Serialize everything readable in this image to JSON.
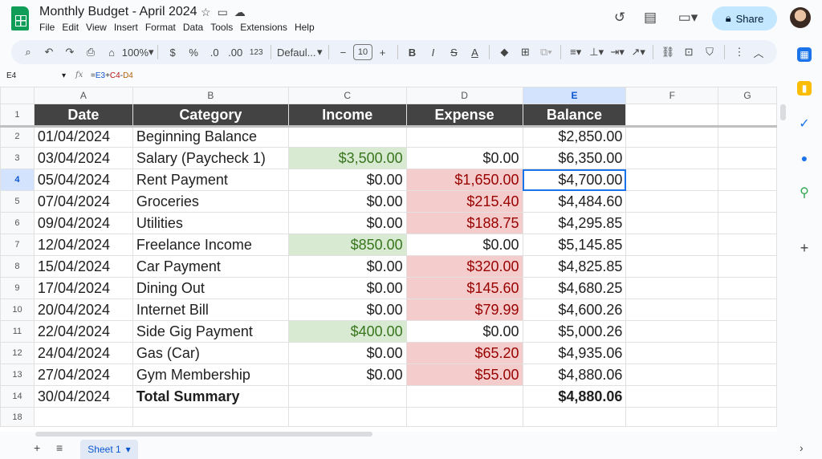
{
  "app": {
    "title": "Monthly Budget - April 2024",
    "share_label": "Share"
  },
  "menu": [
    "File",
    "Edit",
    "View",
    "Insert",
    "Format",
    "Data",
    "Tools",
    "Extensions",
    "Help"
  ],
  "toolbar": {
    "zoom": "100%",
    "currency": "$",
    "percent": "%",
    "decrease_decimal": ".0",
    "increase_decimal": ".00",
    "number_format": "123",
    "font": "Defaul...",
    "font_size": "10"
  },
  "formula_bar": {
    "name_box": "E4",
    "fx": "fx",
    "formula_prefix": "=",
    "ref1": "E3",
    "op1": "+",
    "ref2": "C4",
    "op2": "-",
    "ref3": "D4"
  },
  "columns": [
    "A",
    "B",
    "C",
    "D",
    "E",
    "F",
    "G"
  ],
  "table_headers": [
    "Date",
    "Category",
    "Income",
    "Expense",
    "Balance"
  ],
  "rows": [
    {
      "n": "2",
      "date": "01/04/2024",
      "category": "Beginning Balance",
      "income": "",
      "expense": "",
      "balance": "$2,850.00"
    },
    {
      "n": "3",
      "date": "03/04/2024",
      "category": "Salary (Paycheck 1)",
      "income": "$3,500.00",
      "expense": "$0.00",
      "balance": "$6,350.00"
    },
    {
      "n": "4",
      "date": "05/04/2024",
      "category": "Rent Payment",
      "income": "$0.00",
      "expense": "$1,650.00",
      "balance": "$4,700.00"
    },
    {
      "n": "5",
      "date": "07/04/2024",
      "category": "Groceries",
      "income": "$0.00",
      "expense": "$215.40",
      "balance": "$4,484.60"
    },
    {
      "n": "6",
      "date": "09/04/2024",
      "category": "Utilities",
      "income": "$0.00",
      "expense": "$188.75",
      "balance": "$4,295.85"
    },
    {
      "n": "7",
      "date": "12/04/2024",
      "category": "Freelance Income",
      "income": "$850.00",
      "expense": "$0.00",
      "balance": "$5,145.85"
    },
    {
      "n": "8",
      "date": "15/04/2024",
      "category": "Car Payment",
      "income": "$0.00",
      "expense": "$320.00",
      "balance": "$4,825.85"
    },
    {
      "n": "9",
      "date": "17/04/2024",
      "category": "Dining Out",
      "income": "$0.00",
      "expense": "$145.60",
      "balance": "$4,680.25"
    },
    {
      "n": "10",
      "date": "20/04/2024",
      "category": "Internet Bill",
      "income": "$0.00",
      "expense": "$79.99",
      "balance": "$4,600.26"
    },
    {
      "n": "11",
      "date": "22/04/2024",
      "category": "Side Gig Payment",
      "income": "$400.00",
      "expense": "$0.00",
      "balance": "$5,000.26"
    },
    {
      "n": "12",
      "date": "24/04/2024",
      "category": "Gas (Car)",
      "income": "$0.00",
      "expense": "$65.20",
      "balance": "$4,935.06"
    },
    {
      "n": "13",
      "date": "27/04/2024",
      "category": "Gym Membership",
      "income": "$0.00",
      "expense": "$55.00",
      "balance": "$4,880.06"
    },
    {
      "n": "14",
      "date": "30/04/2024",
      "category": "Total Summary",
      "income": "",
      "expense": "",
      "balance": "$4,880.06"
    }
  ],
  "header_row_number": "1",
  "last_row_number": "18",
  "active_cell": "E4",
  "sheet_tab": "Sheet 1",
  "colors": {
    "income_fill": "#d9ead3",
    "expense_fill": "#f4cccc",
    "header_fill": "#434343",
    "accent": "#1a73e8",
    "share_fill": "#c2e7ff"
  },
  "icons": {
    "title": [
      "star-icon",
      "move-to-folder-icon",
      "cloud-saved-icon"
    ],
    "right": [
      "history-icon",
      "comments-icon",
      "meet-icon",
      "lock-icon"
    ],
    "sidebar": [
      "calendar-icon",
      "keep-icon",
      "tasks-icon",
      "contacts-icon",
      "maps-icon",
      "add-icon"
    ]
  }
}
